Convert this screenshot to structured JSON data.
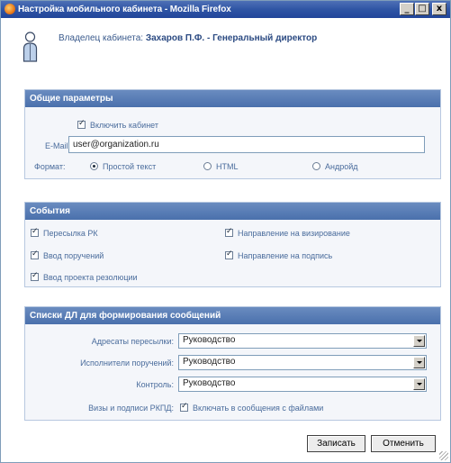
{
  "window": {
    "title": "Настройка мобильного кабинета - Mozilla Firefox",
    "minimize_glyph": "_",
    "maximize_glyph": "□",
    "close_glyph": "x"
  },
  "owner": {
    "label": "Владелец кабинета:",
    "name": "Захаров П.Ф. - Генеральный директор"
  },
  "general": {
    "title": "Общие параметры",
    "enable_label": "Включить кабинет",
    "email_label": "E-Mail:",
    "email_value": "user@organization.ru",
    "format_label": "Формат:",
    "formats": [
      "Простой текст",
      "HTML",
      "Андройд"
    ],
    "format_selected": "Простой текст"
  },
  "events": {
    "title": "События",
    "items": [
      "Пересылка РК",
      "Направление на визирование",
      "Ввод поручений",
      "Направление на подпись",
      "Ввод проекта резолюции"
    ]
  },
  "lists": {
    "title": "Списки ДЛ для формирования сообщений",
    "addressees_label": "Адресаты пересылки:",
    "addressees_value": "Руководство",
    "executors_label": "Исполнители поручений:",
    "executors_value": "Руководство",
    "control_label": "Контроль:",
    "control_value": "Руководство",
    "visas_label": "Визы и подписи РКПД:",
    "visas_checkbox": "Включать в сообщения с файлами"
  },
  "buttons": {
    "save": "Записать",
    "cancel": "Отменить"
  },
  "colors": {
    "titlebar": "#2f55a4",
    "panel_header": "#5a7eb6",
    "label_text": "#4a6c9c"
  }
}
